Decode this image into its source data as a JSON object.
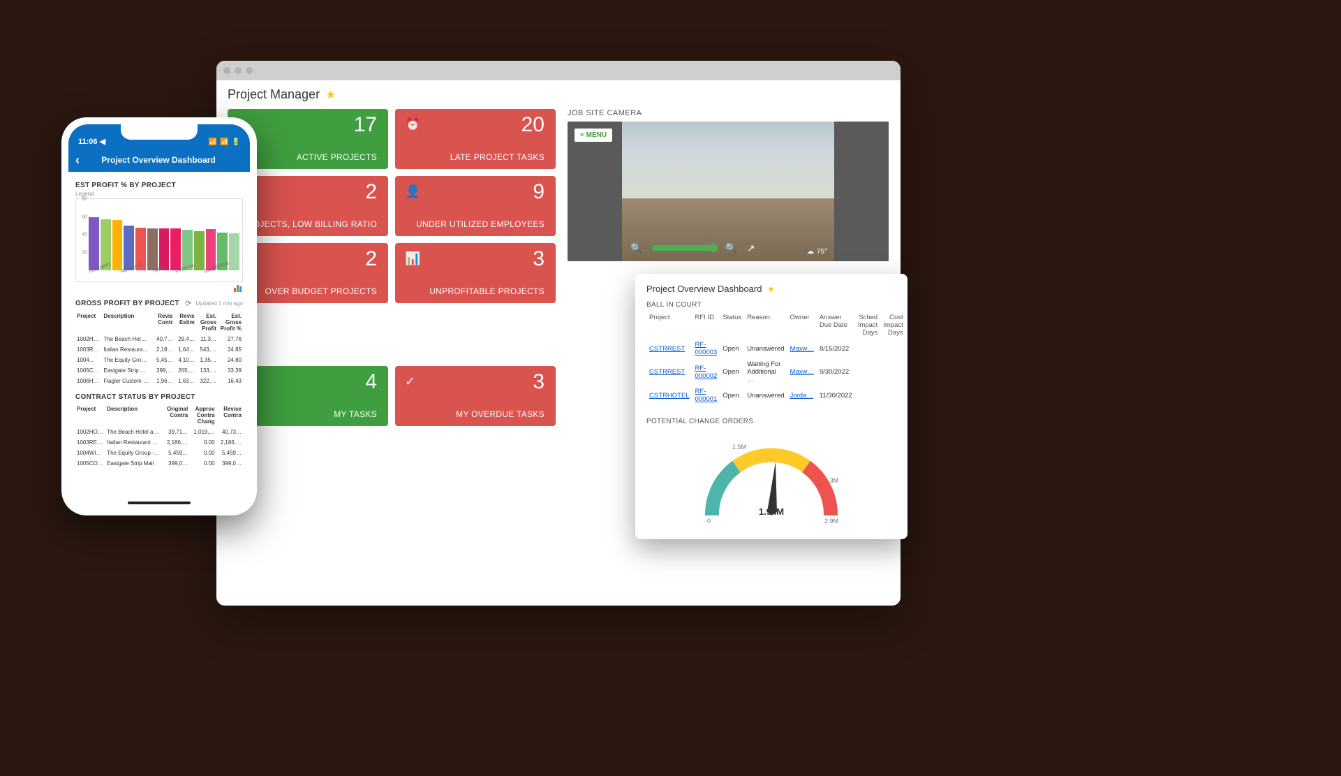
{
  "browser": {
    "title": "Project Manager",
    "tiles": [
      {
        "color": "green",
        "icon": "",
        "value": "17",
        "label": "ACTIVE PROJECTS"
      },
      {
        "color": "red",
        "icon": "⏰",
        "value": "20",
        "label": "LATE PROJECT TASKS"
      },
      {
        "color": "red",
        "icon": "",
        "value": "2",
        "label": "PROJECTS, LOW BILLING RATIO"
      },
      {
        "color": "red",
        "icon": "👤",
        "value": "9",
        "label": "UNDER UTILIZED EMPLOYEES"
      },
      {
        "color": "red",
        "icon": "",
        "value": "2",
        "label": "OVER BUDGET PROJECTS"
      },
      {
        "color": "red",
        "icon": "📊",
        "value": "3",
        "label": "UNPROFITABLE PROJECTS"
      },
      {
        "color": "green",
        "icon": "",
        "value": "4",
        "label": "MY TASKS"
      },
      {
        "color": "red",
        "icon": "✓",
        "value": "3",
        "label": "MY OVERDUE TASKS"
      }
    ],
    "camera": {
      "header": "JOB SITE CAMERA",
      "menu": "≡ MENU",
      "temp": "75°"
    }
  },
  "overview": {
    "title": "Project Overview Dashboard",
    "ball_header": "BALL IN COURT",
    "cols": [
      "Project",
      "RFI ID",
      "Status",
      "Reason",
      "Owner",
      "Answer Due Date",
      "Sched Impact Days",
      "Cost Impact Days"
    ],
    "rows": [
      {
        "project": "CSTRREST",
        "rfi": "RF-000003",
        "status": "Open",
        "reason": "Unanswered",
        "owner": "Maxw…",
        "due": "8/15/2022"
      },
      {
        "project": "CSTRREST",
        "rfi": "RF-000002",
        "status": "Open",
        "reason": "Waiting For Additional …",
        "owner": "Maxw…",
        "due": "9/30/2022"
      },
      {
        "project": "CSTRHOTEL",
        "rfi": "RF-000001",
        "status": "Open",
        "reason": "Unanswered",
        "owner": "Jorda…",
        "due": "11/30/2022"
      }
    ],
    "pco_header": "POTENTIAL CHANGE ORDERS",
    "gauge": {
      "value": "1.94M",
      "min": "0",
      "mid": "1.5M",
      "mid2": "3M",
      "max": "2.9M"
    }
  },
  "phone": {
    "time": "11:06 ◀",
    "nav_title": "Project Overview Dashboard",
    "sect1": "EST PROFIT % BY PROJECT",
    "legend": "Legend",
    "chart_data": {
      "type": "bar",
      "ylim": [
        0,
        80
      ],
      "yticks": [
        80,
        60,
        40,
        20
      ],
      "categories": [
        "ULTICURR1",
        "",
        "REVREC02",
        "",
        "TMR03",
        "",
        "FIXEDP06",
        "",
        "2017PROG01",
        ""
      ],
      "series": [
        {
          "name": "Est Profit %",
          "values": [
            62,
            60,
            59,
            52,
            50,
            49,
            49,
            49,
            47,
            46,
            48,
            44,
            43
          ]
        }
      ],
      "colors": [
        "#7e57c2",
        "#9ccc65",
        "#ffb300",
        "#5c6bc0",
        "#ef5350",
        "#8d6e63",
        "#d81b60",
        "#e91e63",
        "#81c784",
        "#7cb342",
        "#ec407a",
        "#66bb6a",
        "#a5d6a7"
      ]
    },
    "sect2": "GROSS PROFIT BY PROJECT",
    "updated": "Updated 1 min ago",
    "gp_cols": [
      "Project",
      "Description",
      "Revis Contr",
      "Revis Estim",
      "Est. Gross Profit",
      "Est. Gross Profit %"
    ],
    "gp_rows": [
      [
        "1002H…",
        "The Beach Hot…",
        "40,7…",
        "29,4…",
        "11,3…",
        "27.76"
      ],
      [
        "1003R…",
        "Italian Restaura…",
        "2,18…",
        "1,64…",
        "543,…",
        "24.85"
      ],
      [
        "1004…",
        "The Equity Gro…",
        "5,45…",
        "4,10…",
        "1,35…",
        "24.80"
      ],
      [
        "1005C…",
        "Eastgate Strip …",
        "399,…",
        "265,…",
        "133,…",
        "33.39"
      ],
      [
        "1006H…",
        "Flagler Custom …",
        "1,96…",
        "1,63…",
        "322,…",
        "16.43"
      ]
    ],
    "sect3": "CONTRACT STATUS BY PROJECT",
    "cs_cols": [
      "Project",
      "Description",
      "Original Contra",
      "Approv Contra Chang",
      "Revise Contra"
    ],
    "cs_rows": [
      [
        "1002HO…",
        "The Beach Hotel a…",
        "39,71…",
        "1,019,…",
        "40,73…"
      ],
      [
        "1003RE…",
        "Italian Restaurant …",
        "2,186,…",
        "0.00",
        "2,186,…"
      ],
      [
        "1004WI…",
        "The Equity Group -…",
        "5,459…",
        "0.00",
        "5,459…"
      ],
      [
        "1005CO…",
        "Eastgate Strip Mall",
        "399,0…",
        "0.00",
        "399,0…"
      ]
    ]
  },
  "chart_data": {
    "type": "bar",
    "title": "EST PROFIT % BY PROJECT",
    "ylabel": "",
    "xlabel": "",
    "ylim": [
      0,
      80
    ],
    "categories": [
      "ULTICURR1",
      "REVREC02",
      "TMR03",
      "FIXEDP06",
      "2017PROG01"
    ],
    "values": [
      62,
      60,
      59,
      52,
      50,
      49,
      49,
      49,
      47,
      46,
      48,
      44,
      43
    ]
  }
}
